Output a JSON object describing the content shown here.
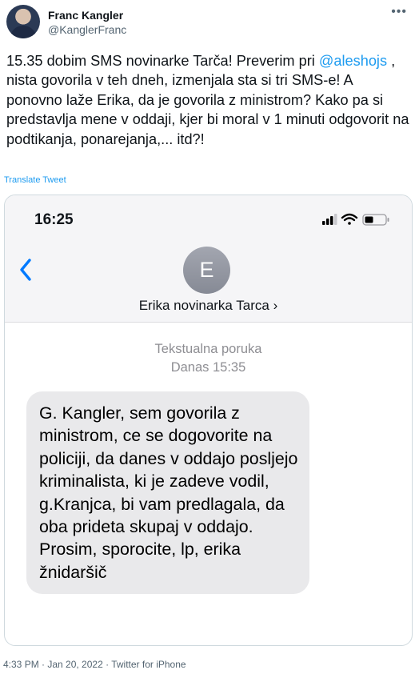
{
  "tweet": {
    "author_name": "Franc Kangler",
    "author_handle": "@KanglerFranc",
    "more_icon": "ellipsis-icon",
    "text_before": "15.35 dobim SMS novinarke Tarča! Preverim pri",
    "mention": "@aleshojs",
    "text_after": ", nista govorila v teh dneh, izmenjala sta si tri SMS-e! A ponovno laže Erika, da je govorila z ministrom? Kako pa si predstavlja mene v oddaji, kjer bi moral v 1 minuti odgovorit na podtikanja, ponarejanja,... itd?!",
    "translate_label": "Translate Tweet",
    "footer": "4:33 PM · Jan 20, 2022 · Twitter for iPhone"
  },
  "screenshot": {
    "time": "16:25",
    "contact_initial": "E",
    "contact_name": "Erika novinarka Tarca ›",
    "message_type": "Tekstualna poruka",
    "message_time": "Danas 15:35",
    "message_text": "G. Kangler, sem govorila z ministrom, ce se dogovorite na policiji, da danes v oddajo posljejo kriminalista, ki je zadeve vodil, g.Kranjca, bi vam predlagala, da oba prideta skupaj v oddajo. Prosim, sporocite, lp, erika žnidaršič"
  },
  "colors": {
    "link": "#1d9bf0",
    "ios_blue": "#007aff",
    "secondary_text": "#536471"
  }
}
